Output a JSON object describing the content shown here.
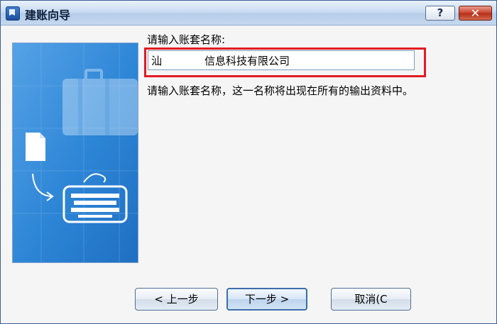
{
  "window": {
    "title": "建账向导"
  },
  "title_buttons": {
    "help": "?",
    "close": "✕"
  },
  "form": {
    "prompt_label": "请输入账套名称:",
    "company_name_value": "汕　　　　信息科技有限公司",
    "description": "请输入账套名称，这一名称将出现在所有的输出资料中。"
  },
  "buttons": {
    "prev": "< 上一步",
    "next": "下一步 >",
    "cancel": "取消(C"
  },
  "colors": {
    "highlight": "#e21b22",
    "sidebar": "#2d85d6"
  },
  "icons": [
    "app-icon",
    "help-icon",
    "close-icon",
    "document-icon",
    "keyboard-icon",
    "briefcase-icon",
    "arrow-icon"
  ]
}
